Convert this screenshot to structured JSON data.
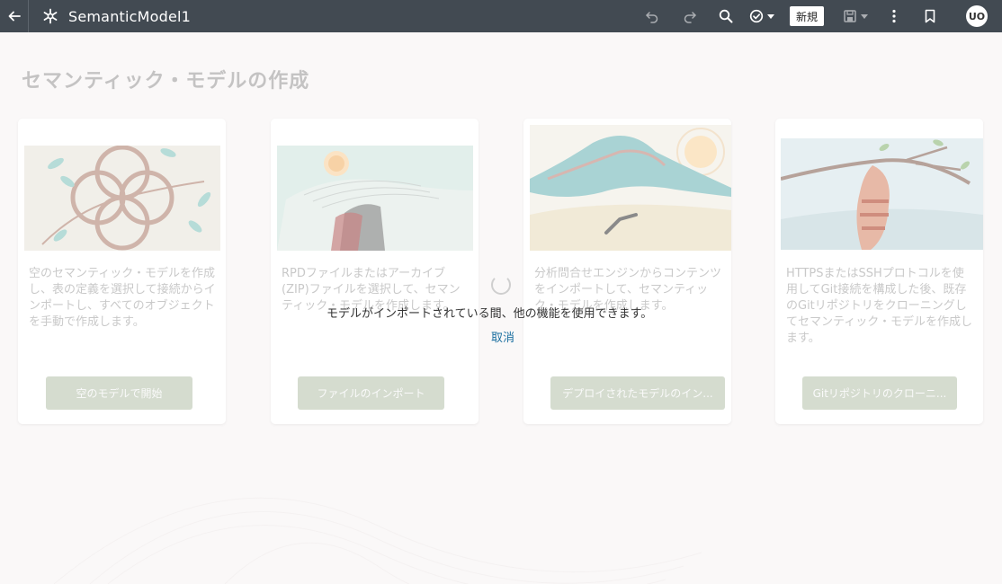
{
  "header": {
    "title": "SemanticModel1",
    "new_label": "新規",
    "avatar_initials": "UO"
  },
  "page": {
    "title": "セマンティック・モデルの作成"
  },
  "cards": [
    {
      "description": "空のセマンティック・モデルを作成し、表の定義を選択して接続からインポートし、すべてのオブジェクトを手動で作成します。",
      "button": "空のモデルで開始"
    },
    {
      "description": "RPDファイルまたはアーカイブ(ZIP)ファイルを選択して、セマンティック・モデルを作成します。",
      "button": "ファイルのインポート"
    },
    {
      "description": "分析問合せエンジンからコンテンツをインポートして、セマンティック・モデルを作成します。",
      "button": "デプロイされたモデルのイン..."
    },
    {
      "description": "HTTPSまたはSSHプロトコルを使用してGit接続を構成した後、既存のGitリポジトリをクローニングしてセマンティック・モデルを作成します。",
      "button": "Gitリポジトリのクローニ..."
    }
  ],
  "overlay": {
    "message": "モデルがインポートされている間、他の機能を使用できます。",
    "cancel_label": "取消"
  },
  "colors": {
    "header_bg": "#424a52",
    "button_bg": "#d5dccf",
    "link": "#1b6fa0"
  }
}
